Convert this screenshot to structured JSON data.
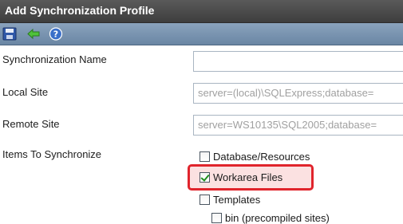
{
  "window": {
    "title": "Add Synchronization Profile"
  },
  "toolbar": {
    "items": [
      {
        "icon": "save-icon"
      },
      {
        "icon": "back-arrow-icon"
      },
      {
        "icon": "help-icon"
      }
    ]
  },
  "form": {
    "sync_name_label": "Synchronization Name",
    "sync_name_value": "",
    "local_site_label": "Local Site",
    "local_site_value": "server=(local)\\SQLExpress;database=",
    "remote_site_label": "Remote Site",
    "remote_site_value": "server=WS10135\\SQL2005;database=",
    "items_label": "Items To Synchronize",
    "items": [
      {
        "label": "Database/Resources",
        "checked": false
      },
      {
        "label": "Workarea Files",
        "checked": true,
        "highlighted": true
      },
      {
        "label": "Templates",
        "checked": false
      },
      {
        "label": "bin (precompiled sites)",
        "checked": false
      }
    ]
  },
  "colors": {
    "titlebar": "#4a4a4a",
    "toolbar": "#7a94b0",
    "highlight_border": "#e0242c",
    "highlight_fill": "#fbe1e1"
  }
}
